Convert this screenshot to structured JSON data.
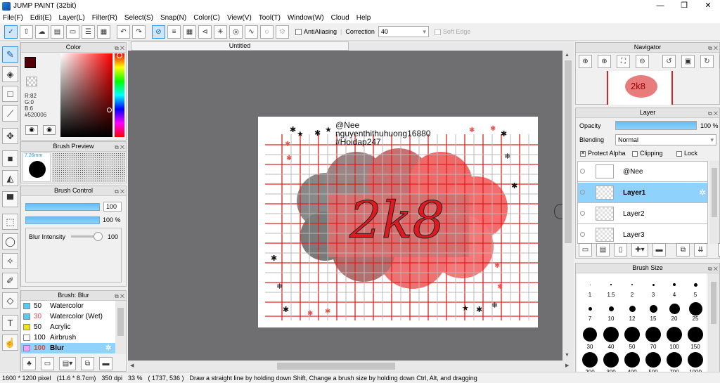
{
  "window": {
    "title": "JUMP PAINT (32bit)",
    "minimize": "—",
    "maximize": "❐",
    "close": "✕"
  },
  "menu": [
    "File(F)",
    "Edit(E)",
    "Layer(L)",
    "Filter(R)",
    "Select(S)",
    "Snap(N)",
    "Color(C)",
    "View(V)",
    "Tool(T)",
    "Window(W)",
    "Cloud",
    "Help"
  ],
  "toolbar": {
    "antialiasing_label": "AntiAliasing",
    "correction_label": "Correction",
    "correction_value": "40",
    "soft_edge_label": "Soft Edge"
  },
  "color_panel": {
    "title": "Color",
    "r": "R:82",
    "g": "G:0",
    "b": "B:6",
    "hex": "#520006",
    "main_color": "#520006"
  },
  "brush_preview": {
    "title": "Brush Preview",
    "size": "7.26mm"
  },
  "brush_control": {
    "title": "Brush Control",
    "size_value": "100",
    "opacity_value": "100 %",
    "blur_label": "Blur Intensity",
    "blur_value": "100"
  },
  "brush_list": {
    "title": "Brush: Blur",
    "items": [
      {
        "size": "50",
        "name": "Watercolor",
        "swatch": "#5bc8f0",
        "size_color": "#000000"
      },
      {
        "size": "30",
        "name": "Watercolor (Wet)",
        "swatch": "#5bc8f0",
        "size_color": "#e04848"
      },
      {
        "size": "50",
        "name": "Acrylic",
        "swatch": "#f0e020",
        "size_color": "#000000"
      },
      {
        "size": "100",
        "name": "Airbrush",
        "swatch": "#ffffff",
        "size_color": "#000000"
      },
      {
        "size": "100",
        "name": "Blur",
        "swatch": "#f4a0f4",
        "size_color": "#e04848"
      }
    ]
  },
  "canvas": {
    "tab": "Untitled",
    "art": {
      "line1": "@Nee",
      "line2": "nguyenthithuhuong16880",
      "line3": "#Hoidap247",
      "center": "2k8"
    }
  },
  "navigator": {
    "title": "Navigator",
    "thumb_text": "2k8"
  },
  "layer_panel": {
    "title": "Layer",
    "opacity_label": "Opacity",
    "opacity_value": "100 %",
    "opacity_fraction": 1.0,
    "blending_label": "Blending",
    "blending_value": "Normal",
    "protect_alpha": "Protect Alpha",
    "clipping": "Clipping",
    "lock": "Lock",
    "layers": [
      {
        "name": "@Nee",
        "selected": false
      },
      {
        "name": "Layer1",
        "selected": true
      },
      {
        "name": "Layer2",
        "selected": false
      },
      {
        "name": "Layer3",
        "selected": false
      }
    ]
  },
  "brush_size": {
    "title": "Brush Size",
    "rows": [
      [
        "1",
        "1.5",
        "2",
        "3",
        "4",
        "5"
      ],
      [
        "7",
        "10",
        "12",
        "15",
        "20",
        "25"
      ],
      [
        "30",
        "40",
        "50",
        "70",
        "100",
        "150"
      ],
      [
        "200",
        "300",
        "400",
        "500",
        "700",
        "1000"
      ]
    ]
  },
  "status": {
    "dimensions": "1600 * 1200 pixel",
    "physical": "(11.6 * 8.7cm)",
    "dpi": "350 dpi",
    "zoom": "33 %",
    "coords": "( 1737, 536 )",
    "hint": "Draw a straight line by holding down Shift, Change a brush size by holding down Ctrl, Alt, and dragging"
  }
}
